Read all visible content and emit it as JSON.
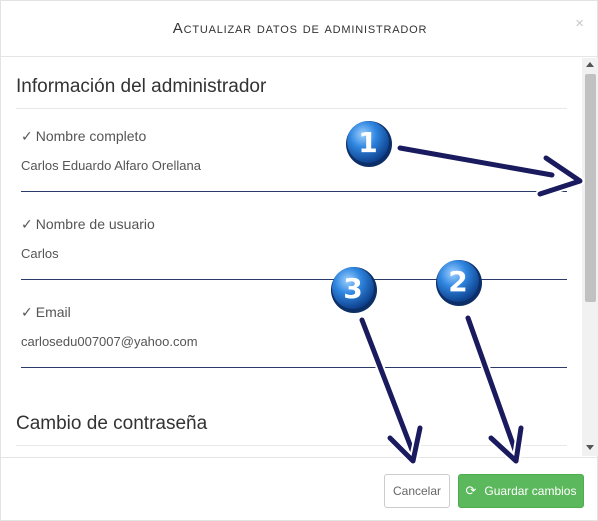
{
  "modal": {
    "title": "Actualizar datos de administrador",
    "close_glyph": "×",
    "close_icon": "close-icon"
  },
  "sections": {
    "admin_info": "Información del administrador",
    "password_change": "Cambio de contraseña"
  },
  "fields": [
    {
      "check": "✓",
      "label": "Nombre completo",
      "value": "Carlos Eduardo Alfaro Orellana"
    },
    {
      "check": "✓",
      "label": "Nombre de usuario",
      "value": "Carlos"
    },
    {
      "check": "✓",
      "label": "Email",
      "value": "carlosedu007007@yahoo.com"
    }
  ],
  "footer": {
    "cancel_label": "Cancelar",
    "save_label": "Guardar cambios",
    "save_icon": "refresh-icon",
    "save_icon_glyph": "⟳"
  },
  "annotations": [
    "1",
    "2",
    "3"
  ],
  "colors": {
    "accent_green": "#5cb85c",
    "underline_navy": "#2a3a6b",
    "arrow_navy": "#1a1a5e",
    "badge_blue": "#1f6fd0"
  }
}
